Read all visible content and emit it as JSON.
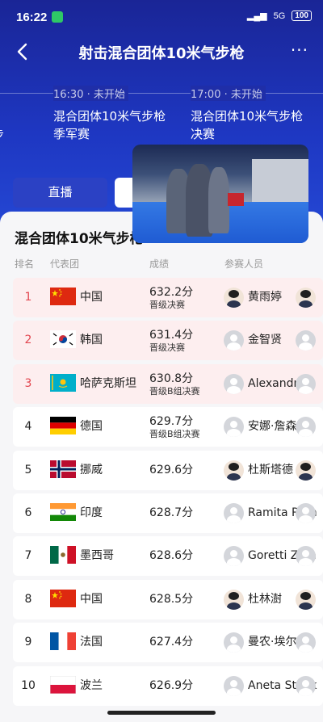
{
  "status_bar": {
    "time": "16:22",
    "network": "5G",
    "battery": "100"
  },
  "nav": {
    "title": "射击混合团体10米气步枪"
  },
  "schedule": [
    {
      "time": "",
      "name": "步"
    },
    {
      "time": "16:30 · 未开始",
      "name": "混合团体10米气步枪季军赛"
    },
    {
      "time": "17:00 · 未开始",
      "name": "混合团体10米气步枪决赛"
    }
  ],
  "tabs": {
    "live": "直播"
  },
  "card": {
    "title": "混合团体10米气步枪"
  },
  "columns": {
    "rank": "排名",
    "team": "代表团",
    "score": "成绩",
    "athletes": "参赛人员"
  },
  "rows": [
    {
      "rank": "1",
      "country": "中国",
      "flag": "china",
      "score": "632.2分",
      "note": "晋级决赛",
      "athlete": "黄雨婷",
      "highlight": true
    },
    {
      "rank": "2",
      "country": "韩国",
      "flag": "korea",
      "score": "631.4分",
      "note": "晋级决赛",
      "athlete": "金智贤",
      "highlight": true
    },
    {
      "rank": "3",
      "country": "哈萨克斯坦",
      "flag": "kazakhstan",
      "score": "630.8分",
      "note": "晋级B组决赛",
      "athlete": "Alexandra L",
      "highlight": true
    },
    {
      "rank": "4",
      "country": "德国",
      "flag": "germany",
      "score": "629.7分",
      "note": "晋级B组决赛",
      "athlete": "安娜·詹森",
      "highlight": false
    },
    {
      "rank": "5",
      "country": "挪威",
      "flag": "norway",
      "score": "629.6分",
      "note": "",
      "athlete": "杜斯塔德",
      "highlight": false
    },
    {
      "rank": "6",
      "country": "印度",
      "flag": "india",
      "score": "628.7分",
      "note": "",
      "athlete": "Ramita Ram",
      "highlight": false
    },
    {
      "rank": "7",
      "country": "墨西哥",
      "flag": "mexico",
      "score": "628.6分",
      "note": "",
      "athlete": "Goretti Zum",
      "highlight": false
    },
    {
      "rank": "8",
      "country": "中国",
      "flag": "china",
      "score": "628.5分",
      "note": "",
      "athlete": "杜林澍",
      "highlight": false
    },
    {
      "rank": "9",
      "country": "法国",
      "flag": "france",
      "score": "627.4分",
      "note": "",
      "athlete": "曼农·埃尔布",
      "highlight": false
    },
    {
      "rank": "10",
      "country": "波兰",
      "flag": "poland",
      "score": "626.9分",
      "note": "",
      "athlete": "Aneta Stank",
      "highlight": false
    }
  ],
  "colors": {
    "accent": "#1e37c2",
    "highlight_row": "#fdeeef",
    "rank_highlight": "#e2464f"
  }
}
